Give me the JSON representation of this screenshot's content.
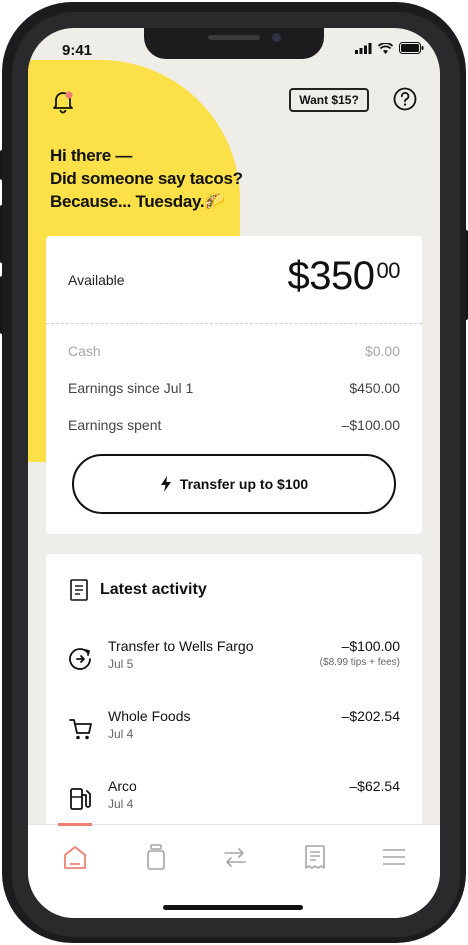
{
  "status_bar": {
    "time": "9:41"
  },
  "header": {
    "promo_label": "Want $15?"
  },
  "greeting": {
    "lines": [
      "Hi there —",
      "Did someone say tacos?",
      "Because... Tuesday.🌮"
    ]
  },
  "balance": {
    "available_label": "Available",
    "amount_main": "$350",
    "amount_cents": "00",
    "rows": [
      {
        "label": "Cash",
        "value": "$0.00"
      },
      {
        "label": "Earnings since Jul 1",
        "value": "$450.00"
      },
      {
        "label": "Earnings spent",
        "value": "–$100.00"
      }
    ],
    "transfer_label": "Transfer up to $100"
  },
  "activity": {
    "title": "Latest activity",
    "items": [
      {
        "name": "Transfer to Wells Fargo",
        "date": "Jul 5",
        "amount": "–$100.00",
        "sub": "($8.99 tips + fees)",
        "icon": "transfer-out-icon"
      },
      {
        "name": "Whole Foods",
        "date": "Jul 4",
        "amount": "–$202.54",
        "icon": "shopping-cart-icon"
      },
      {
        "name": "Arco",
        "date": "Jul 4",
        "amount": "–$62.54",
        "icon": "gas-pump-icon"
      }
    ]
  },
  "tabs": [
    {
      "icon": "home-icon",
      "active": true
    },
    {
      "icon": "jar-icon"
    },
    {
      "icon": "transfer-icon"
    },
    {
      "icon": "receipt-icon"
    },
    {
      "icon": "menu-icon"
    }
  ],
  "colors": {
    "accent_yellow": "#fbe147",
    "accent_coral": "#ef7f75",
    "background": "#efede8"
  }
}
